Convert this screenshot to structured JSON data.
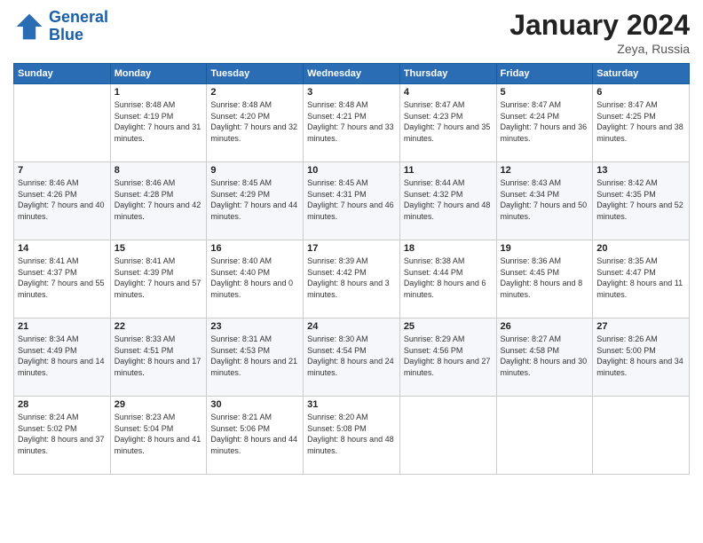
{
  "header": {
    "logo_line1": "General",
    "logo_line2": "Blue",
    "month": "January 2024",
    "location": "Zeya, Russia"
  },
  "days_of_week": [
    "Sunday",
    "Monday",
    "Tuesday",
    "Wednesday",
    "Thursday",
    "Friday",
    "Saturday"
  ],
  "weeks": [
    [
      {
        "day": null
      },
      {
        "day": "1",
        "sunrise": "8:48 AM",
        "sunset": "4:19 PM",
        "daylight": "7 hours and 31 minutes."
      },
      {
        "day": "2",
        "sunrise": "8:48 AM",
        "sunset": "4:20 PM",
        "daylight": "7 hours and 32 minutes."
      },
      {
        "day": "3",
        "sunrise": "8:48 AM",
        "sunset": "4:21 PM",
        "daylight": "7 hours and 33 minutes."
      },
      {
        "day": "4",
        "sunrise": "8:47 AM",
        "sunset": "4:23 PM",
        "daylight": "7 hours and 35 minutes."
      },
      {
        "day": "5",
        "sunrise": "8:47 AM",
        "sunset": "4:24 PM",
        "daylight": "7 hours and 36 minutes."
      },
      {
        "day": "6",
        "sunrise": "8:47 AM",
        "sunset": "4:25 PM",
        "daylight": "7 hours and 38 minutes."
      }
    ],
    [
      {
        "day": "7",
        "sunrise": "8:46 AM",
        "sunset": "4:26 PM",
        "daylight": "7 hours and 40 minutes."
      },
      {
        "day": "8",
        "sunrise": "8:46 AM",
        "sunset": "4:28 PM",
        "daylight": "7 hours and 42 minutes."
      },
      {
        "day": "9",
        "sunrise": "8:45 AM",
        "sunset": "4:29 PM",
        "daylight": "7 hours and 44 minutes."
      },
      {
        "day": "10",
        "sunrise": "8:45 AM",
        "sunset": "4:31 PM",
        "daylight": "7 hours and 46 minutes."
      },
      {
        "day": "11",
        "sunrise": "8:44 AM",
        "sunset": "4:32 PM",
        "daylight": "7 hours and 48 minutes."
      },
      {
        "day": "12",
        "sunrise": "8:43 AM",
        "sunset": "4:34 PM",
        "daylight": "7 hours and 50 minutes."
      },
      {
        "day": "13",
        "sunrise": "8:42 AM",
        "sunset": "4:35 PM",
        "daylight": "7 hours and 52 minutes."
      }
    ],
    [
      {
        "day": "14",
        "sunrise": "8:41 AM",
        "sunset": "4:37 PM",
        "daylight": "7 hours and 55 minutes."
      },
      {
        "day": "15",
        "sunrise": "8:41 AM",
        "sunset": "4:39 PM",
        "daylight": "7 hours and 57 minutes."
      },
      {
        "day": "16",
        "sunrise": "8:40 AM",
        "sunset": "4:40 PM",
        "daylight": "8 hours and 0 minutes."
      },
      {
        "day": "17",
        "sunrise": "8:39 AM",
        "sunset": "4:42 PM",
        "daylight": "8 hours and 3 minutes."
      },
      {
        "day": "18",
        "sunrise": "8:38 AM",
        "sunset": "4:44 PM",
        "daylight": "8 hours and 6 minutes."
      },
      {
        "day": "19",
        "sunrise": "8:36 AM",
        "sunset": "4:45 PM",
        "daylight": "8 hours and 8 minutes."
      },
      {
        "day": "20",
        "sunrise": "8:35 AM",
        "sunset": "4:47 PM",
        "daylight": "8 hours and 11 minutes."
      }
    ],
    [
      {
        "day": "21",
        "sunrise": "8:34 AM",
        "sunset": "4:49 PM",
        "daylight": "8 hours and 14 minutes."
      },
      {
        "day": "22",
        "sunrise": "8:33 AM",
        "sunset": "4:51 PM",
        "daylight": "8 hours and 17 minutes."
      },
      {
        "day": "23",
        "sunrise": "8:31 AM",
        "sunset": "4:53 PM",
        "daylight": "8 hours and 21 minutes."
      },
      {
        "day": "24",
        "sunrise": "8:30 AM",
        "sunset": "4:54 PM",
        "daylight": "8 hours and 24 minutes."
      },
      {
        "day": "25",
        "sunrise": "8:29 AM",
        "sunset": "4:56 PM",
        "daylight": "8 hours and 27 minutes."
      },
      {
        "day": "26",
        "sunrise": "8:27 AM",
        "sunset": "4:58 PM",
        "daylight": "8 hours and 30 minutes."
      },
      {
        "day": "27",
        "sunrise": "8:26 AM",
        "sunset": "5:00 PM",
        "daylight": "8 hours and 34 minutes."
      }
    ],
    [
      {
        "day": "28",
        "sunrise": "8:24 AM",
        "sunset": "5:02 PM",
        "daylight": "8 hours and 37 minutes."
      },
      {
        "day": "29",
        "sunrise": "8:23 AM",
        "sunset": "5:04 PM",
        "daylight": "8 hours and 41 minutes."
      },
      {
        "day": "30",
        "sunrise": "8:21 AM",
        "sunset": "5:06 PM",
        "daylight": "8 hours and 44 minutes."
      },
      {
        "day": "31",
        "sunrise": "8:20 AM",
        "sunset": "5:08 PM",
        "daylight": "8 hours and 48 minutes."
      },
      {
        "day": null
      },
      {
        "day": null
      },
      {
        "day": null
      }
    ]
  ]
}
